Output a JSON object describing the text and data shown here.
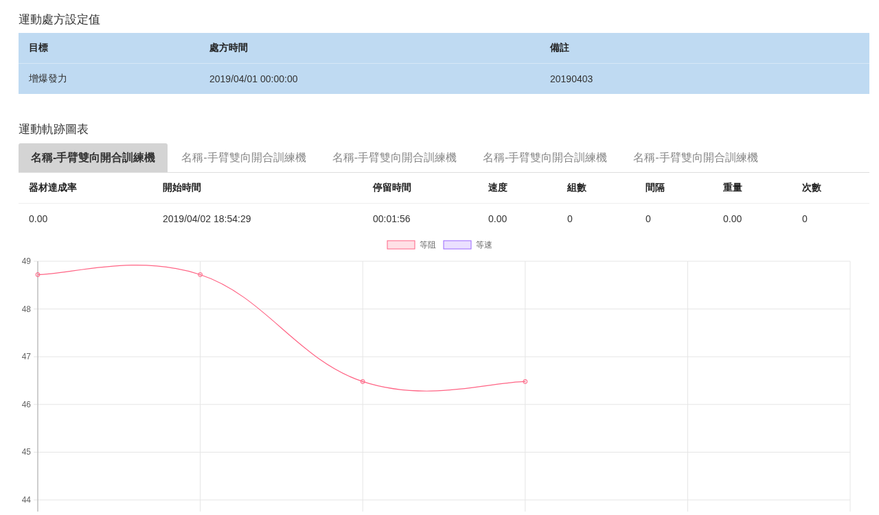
{
  "prescription": {
    "title": "運動處方設定值",
    "columns": [
      "目標",
      "處方時間",
      "備註"
    ],
    "rows": [
      [
        "增爆發力",
        "2019/04/01 00:00:00",
        "20190403"
      ]
    ]
  },
  "trajectory": {
    "title": "運動軌跡圖表",
    "tabs": [
      {
        "label": "名稱-手臂雙向開合訓練機",
        "selected": true
      },
      {
        "label": "名稱-手臂雙向開合訓練機",
        "selected": false
      },
      {
        "label": "名稱-手臂雙向開合訓練機",
        "selected": false
      },
      {
        "label": "名稱-手臂雙向開合訓練機",
        "selected": false
      },
      {
        "label": "名稱-手臂雙向開合訓練機",
        "selected": false
      }
    ],
    "table": {
      "columns": [
        "器材達成率",
        "開始時間",
        "停留時間",
        "速度",
        "組數",
        "間隔",
        "重量",
        "次數"
      ],
      "rows": [
        [
          "0.00",
          "2019/04/02 18:54:29",
          "00:01:56",
          "0.00",
          "0",
          "0",
          "0.00",
          "0"
        ]
      ]
    },
    "chart_data": {
      "type": "line",
      "grid": true,
      "categories": [
        null,
        null,
        null,
        null,
        null,
        null
      ],
      "ylim": [
        43.76,
        49
      ],
      "yticks": [
        44,
        45,
        46,
        47,
        48,
        49
      ],
      "series": [
        {
          "name": "等阻",
          "color": "#ff6384",
          "marker": "circle",
          "values": [
            48.72,
            48.72,
            46.48,
            46.48,
            null,
            null
          ]
        },
        {
          "name": "等速",
          "color": "#9966ff",
          "values": [
            null,
            null,
            null,
            null,
            null,
            null
          ]
        }
      ]
    }
  }
}
